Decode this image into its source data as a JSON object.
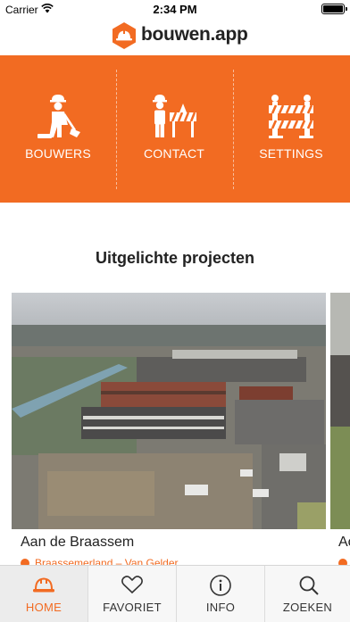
{
  "status_bar": {
    "carrier": "Carrier",
    "time": "2:34 PM"
  },
  "brand": {
    "name": "bouwen.app",
    "accent": "#f26b22"
  },
  "nav": [
    {
      "label": "BOUWERS",
      "icon": "construction-worker-icon"
    },
    {
      "label": "CONTACT",
      "icon": "worker-with-barrier-icon"
    },
    {
      "label": "SETTINGS",
      "icon": "road-barrier-icon"
    }
  ],
  "featured": {
    "title": "Uitgelichte projecten",
    "projects": [
      {
        "name": "Aan de Braassem",
        "location": "Braassemerland – Van Gelder"
      },
      {
        "name": "Ac",
        "location": ""
      }
    ]
  },
  "tabs": [
    {
      "label": "HOME",
      "icon": "helmet-icon",
      "active": true
    },
    {
      "label": "FAVORIET",
      "icon": "heart-icon",
      "active": false
    },
    {
      "label": "INFO",
      "icon": "info-icon",
      "active": false
    },
    {
      "label": "ZOEKEN",
      "icon": "search-icon",
      "active": false
    }
  ]
}
